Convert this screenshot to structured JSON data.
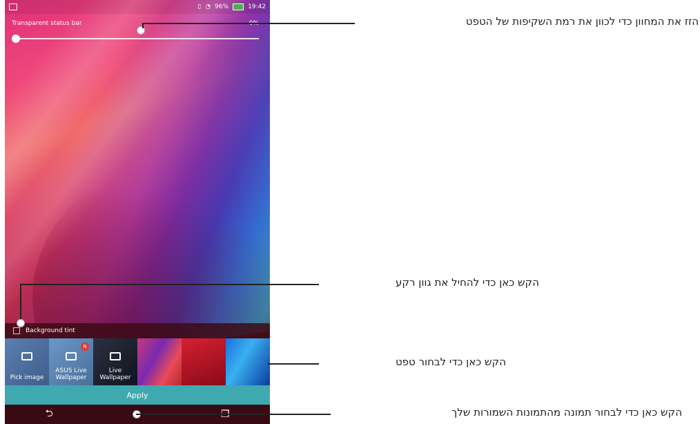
{
  "status_bar": {
    "time": "19:42",
    "battery": "96%"
  },
  "screen": {
    "transparent_label": "Transparent status bar",
    "percent": "0%",
    "background_tint_label": "Background tint",
    "thumbnails": [
      {
        "label": "Pick image"
      },
      {
        "label": "ASUS Live\nWallpaper",
        "badge": "N"
      },
      {
        "label": "Live Wallpaper"
      },
      {
        "label": ""
      },
      {
        "label": ""
      },
      {
        "label": ""
      }
    ],
    "apply_label": "Apply"
  },
  "callouts": {
    "slider": "הזז את המחוון כדי לכוון את רמת השקיפות של הטפט",
    "tint": "הקש כאן כדי להחיל את גוון רקע",
    "wallpaper": "הקש כאן כדי לבחור טפט",
    "gallery": "הקש כאן כדי לבחור תמונה מהתמונות השמורות שלך"
  }
}
